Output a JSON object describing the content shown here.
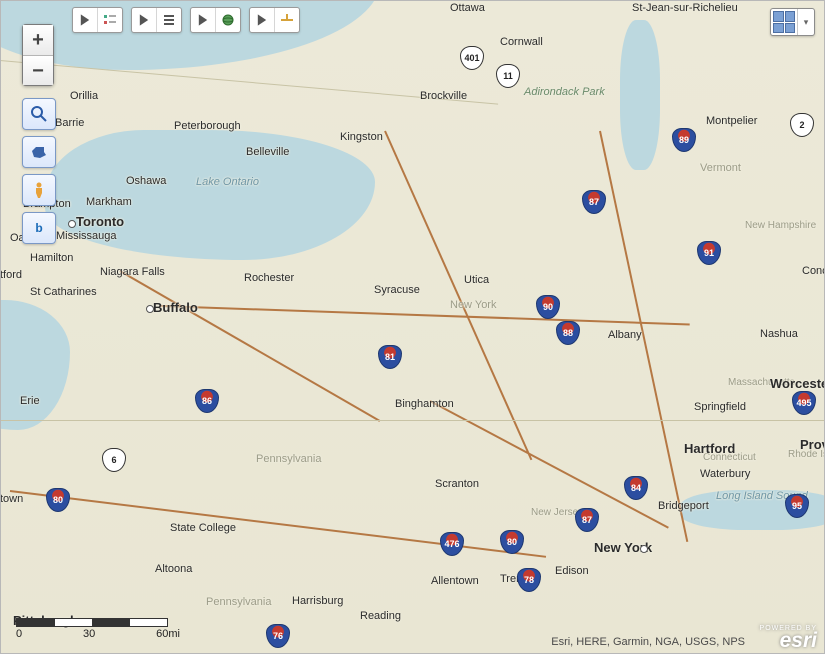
{
  "toolbar": {
    "group1": {
      "btn1": "legend-toggle",
      "btn2": "legend-panel"
    },
    "group2": {
      "btn1": "layers-toggle",
      "btn2": "layers-list"
    },
    "group3": {
      "btn1": "basemap-toggle",
      "btn2": "basemap-globe"
    },
    "group4": {
      "btn1": "measure-tool"
    }
  },
  "zoom": {
    "in": "+",
    "out": "−"
  },
  "left_tools": {
    "magnify": "zoom-rectangle",
    "ny_shape": "ny-boundary",
    "streetview": "street-view",
    "bing": "bing-maps"
  },
  "basemap_picker": {
    "label": "basemap-gallery",
    "arrow": "▾"
  },
  "scale": {
    "v0": "0",
    "v1": "30",
    "v2": "60mi"
  },
  "attribution": "Esri, HERE, Garmin, NGA, USGS, NPS",
  "esri": {
    "powered": "POWERED BY",
    "logo": "esri"
  },
  "regions": {
    "ny": "New York",
    "pa": "Pennsylvania",
    "pa2": "Pennsylvania",
    "vt": "Vermont",
    "nh": "New Hampshire",
    "ma": "Massachusetts",
    "ct": "Connecticut",
    "ri": "Rhode Island",
    "nj": "New Jersey",
    "adk": "Adirondack Park",
    "lakeont": "Lake Ontario",
    "lis": "Long Island Sound"
  },
  "cities": {
    "toronto": "Toronto",
    "mississauga": "Mississauga",
    "markham": "Markham",
    "oshawa": "Oshawa",
    "brampton": "Brampton",
    "oakville": "Oakville",
    "hamilton": "Hamilton",
    "stcath": "St Catharines",
    "niagara": "Niagara Falls",
    "peterborough": "Peterborough",
    "orillia": "Orillia",
    "barrie": "Barrie",
    "belleville": "Belleville",
    "kingston": "Kingston",
    "brockville": "Brockville",
    "cornwall": "Cornwall",
    "ottawa": "Ottawa",
    "stjean": "St-Jean-sur-Richelieu",
    "buffalo": "Buffalo",
    "rochester": "Rochester",
    "syracuse": "Syracuse",
    "utica": "Utica",
    "albany": "Albany",
    "binghamton": "Binghamton",
    "scranton": "Scranton",
    "allentown": "Allentown",
    "reading": "Reading",
    "harrisburg": "Harrisburg",
    "statecollege": "State College",
    "altoona": "Altoona",
    "pittsburgh": "Pittsburgh",
    "erie": "Erie",
    "trenton": "Trenton",
    "edison": "Edison",
    "newyork": "New York",
    "bridgeport": "Bridgeport",
    "waterbury": "Waterbury",
    "hartford": "Hartford",
    "springfield": "Springfield",
    "worcester": "Worcester",
    "nashua": "Nashua",
    "provi": "Provi",
    "montpelier": "Montpelier",
    "conc": "Conc",
    "tford": "tford",
    "town": "town"
  },
  "highways": {
    "i89": "89",
    "i87a": "87",
    "i87b": "87",
    "i91": "91",
    "i90": "90",
    "i88": "88",
    "i81": "81",
    "i86": "86",
    "i84": "84",
    "i80a": "80",
    "i80b": "80",
    "i476": "476",
    "i78": "78",
    "i76": "76",
    "i495": "495",
    "i95": "95",
    "us2": "2",
    "us11": "11",
    "us401": "401",
    "us6": "6"
  }
}
